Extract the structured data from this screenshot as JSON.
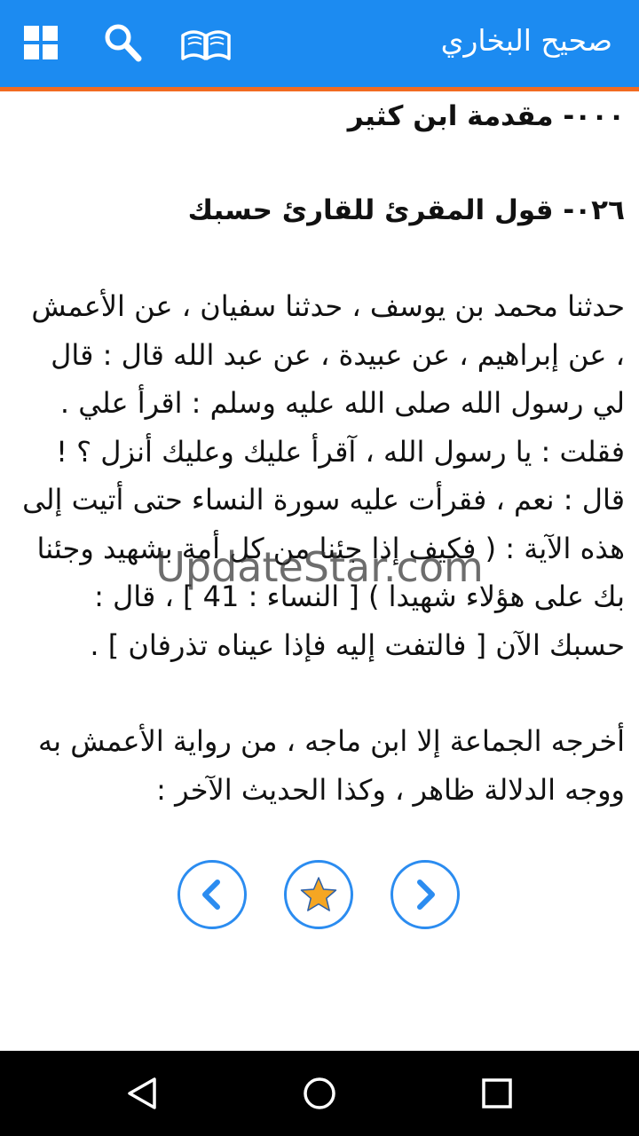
{
  "app": {
    "title": "صحيح البخاري"
  },
  "toolbar": {
    "icons": [
      "grid-icon",
      "search-icon",
      "open-book-icon"
    ]
  },
  "content": {
    "heading_1": "٠٠٠- مقدمة ابن كثير",
    "heading_2": "٠٢٦- قول المقرئ للقارئ حسبك",
    "paragraph_1": "حدثنا محمد بن يوسف ، حدثنا سفيان ، عن الأعمش ، عن إبراهيم ، عن عبيدة ، عن عبد الله قال : قال لي رسول الله صلى الله عليه وسلم : اقرأ علي . فقلت : يا رسول الله ، آقرأ عليك وعليك أنزل ؟ ! قال : نعم ، فقرأت عليه سورة النساء حتى أتيت إلى هذه الآية : ( فكيف إذا جئنا من كل أمة بشهيد وجئنا بك على هؤلاء شهيدا ) [ النساء : 41 ] ، قال : حسبك الآن [ فالتفت إليه فإذا عيناه تذرفان ] .",
    "paragraph_2": "أخرجه الجماعة إلا ابن ماجه ، من رواية الأعمش به ووجه الدلالة ظاهر ، وكذا الحديث الآخر :"
  },
  "watermark": "UpdateStar.com",
  "navigation": {
    "icons": [
      "chevron-left-icon",
      "star-icon",
      "chevron-right-icon"
    ]
  },
  "system_bar": {
    "icons": [
      "back-icon",
      "home-icon",
      "recents-icon"
    ]
  },
  "colors": {
    "appbar": "#1c8bf1",
    "accent_line": "#f26b21",
    "nav_ring": "#2b8cf0",
    "star": "#f5a623"
  }
}
